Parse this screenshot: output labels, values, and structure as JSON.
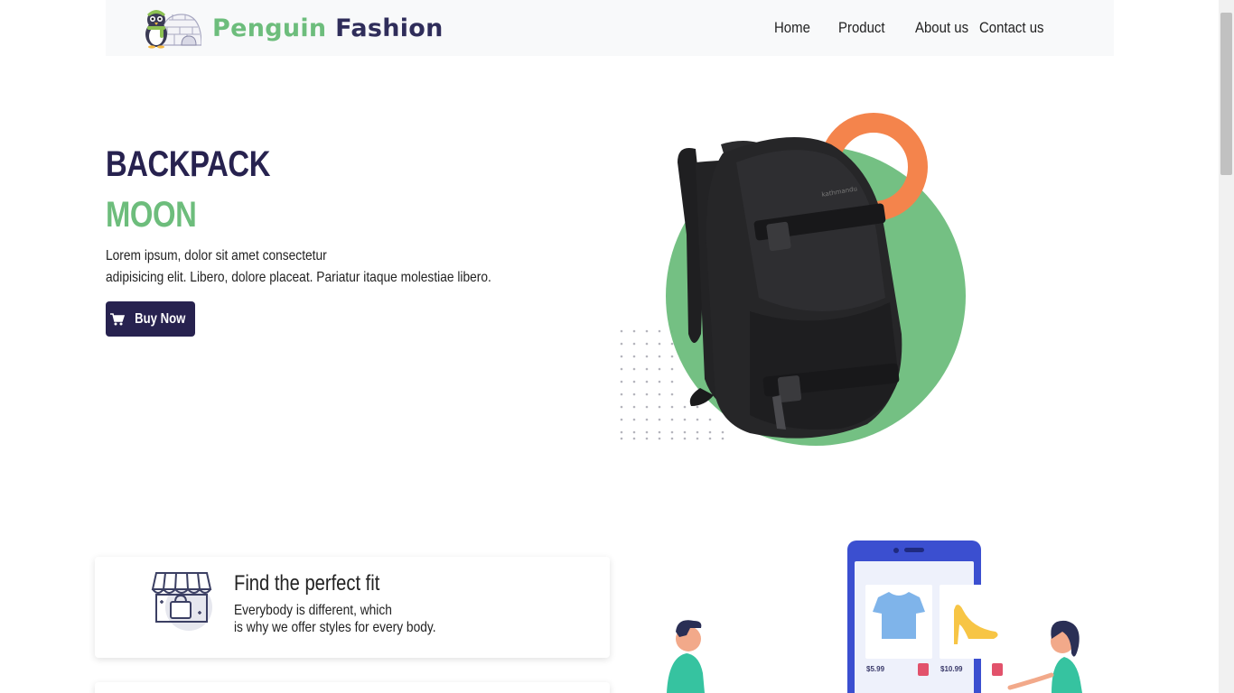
{
  "brand": {
    "name_part1": "Penguin",
    "name_part2": "Fashion"
  },
  "nav": {
    "home": "Home",
    "product": "Product",
    "about": "About us",
    "contact": "Contact us"
  },
  "hero": {
    "title": "BACKPACK",
    "subtitle": "MOON",
    "desc_line1": "Lorem ipsum, dolor sit amet consectetur",
    "desc_line2": "adipisicing elit. Libero, dolore placeat. Pariatur itaque molestiae libero.",
    "button": "Buy Now"
  },
  "feature": {
    "title": "Find the perfect fit",
    "text_line1": "Everybody is different, which",
    "text_line2": "is why we offer styles for every body."
  },
  "shop_illustration": {
    "price1": "$5.99",
    "price2": "$10.99"
  },
  "colors": {
    "primary": "#27224f",
    "accent_green": "#6dbd7c",
    "accent_orange": "#f4844c",
    "phone_blue": "#3b4fd0"
  },
  "icons": {
    "cart": "cart-icon",
    "store": "store-icon",
    "logo": "penguin-igloo-logo"
  }
}
